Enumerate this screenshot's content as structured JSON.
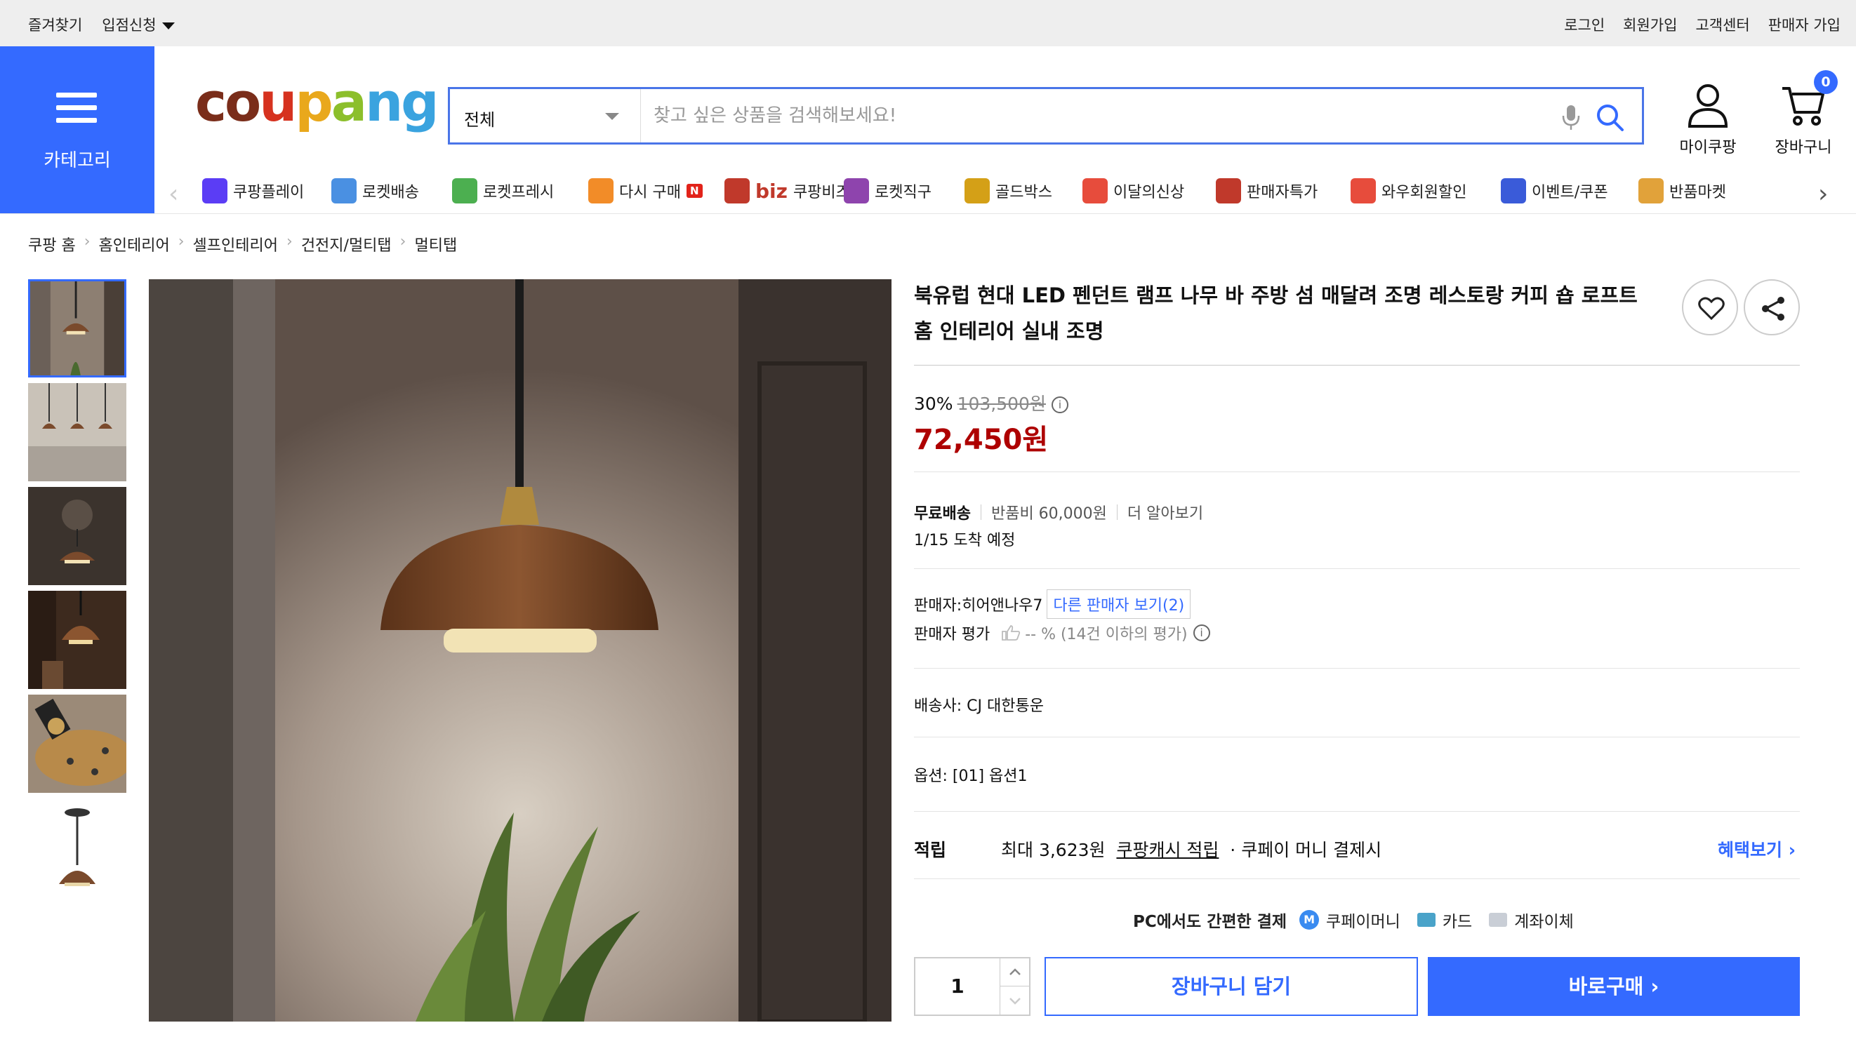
{
  "topbar": {
    "left": [
      "즐겨찾기",
      "입점신청"
    ],
    "right": [
      "로그인",
      "회원가입",
      "고객센터",
      "판매자 가입"
    ]
  },
  "category_label": "카테고리",
  "logo": "coupang",
  "search": {
    "category": "전체",
    "placeholder": "찾고 싶은 상품을 검색해보세요!"
  },
  "header_icons": {
    "mypage": "마이쿠팡",
    "cart": "장바구니",
    "cart_count": "0"
  },
  "nav": {
    "items": [
      {
        "label": "쿠팡플레이",
        "icon": "play-icon"
      },
      {
        "label": "로켓배송",
        "icon": "rocket-icon"
      },
      {
        "label": "로켓프레시",
        "icon": "rocket-fresh-icon"
      },
      {
        "label": "다시 구매",
        "icon": "rebuy-icon",
        "badge": "N"
      },
      {
        "label": "쿠팡비즈",
        "icon": "biz-icon",
        "prefix": "biz"
      },
      {
        "label": "로켓직구",
        "icon": "global-rocket-icon"
      },
      {
        "label": "골드박스",
        "icon": "goldbox-icon"
      },
      {
        "label": "이달의신상",
        "icon": "new-icon"
      },
      {
        "label": "판매자특가",
        "icon": "percent-icon"
      },
      {
        "label": "와우회원할인",
        "icon": "wow-icon"
      },
      {
        "label": "이벤트/쿠폰",
        "icon": "coupon-icon"
      },
      {
        "label": "반품마켓",
        "icon": "sale-icon"
      }
    ],
    "colors": [
      "#5b3df5",
      "#4a90e2",
      "#4caf50",
      "#f28c28",
      "#c0392b",
      "#8e44ad",
      "#d4a017",
      "#e74c3c",
      "#c0392b",
      "#e74c3c",
      "#3a5bd9",
      "#e1a23a"
    ]
  },
  "breadcrumb": [
    "쿠팡 홈",
    "홈인테리어",
    "셀프인테리어",
    "건전지/멀티탭",
    "멀티탭"
  ],
  "product": {
    "title": "북유럽 현대 LED 펜던트 램프 나무 바 주방 섬 매달려 조명 레스토랑 커피 숍 로프트 홈 인테리어 실내 조명",
    "discount": "30%",
    "original_price": "103,500원",
    "price": "72,450원",
    "shipping_label": "무료배송",
    "return_fee": "반품비 60,000원",
    "learn_more": "더 알아보기",
    "arrival": "1/15 도착 예정",
    "seller": "판매자:히어앤나우7",
    "other_sellers": "다른 판매자 보기(2)",
    "seller_rating_label": "판매자 평가",
    "seller_rating": "-- % (14건 이하의 평가)",
    "courier": "배송사:  CJ 대한통운",
    "option": "옵션:  [01] 옵션1",
    "reward_label": "적립",
    "reward_text_prefix": "최대 3,623원",
    "reward_link": "쿠팡캐시 적립",
    "reward_text_suffix": "· 쿠페이 머니 결제시",
    "benefit": "혜택보기 ›",
    "pay_title": "PC에서도 간편한 결제",
    "pay_methods": [
      "쿠페이머니",
      "카드",
      "계좌이체"
    ],
    "quantity": "1",
    "cart_button": "장바구니 담기",
    "buy_button": "바로구매 ›"
  },
  "accent": "#346aff",
  "price_color": "#ae0000"
}
